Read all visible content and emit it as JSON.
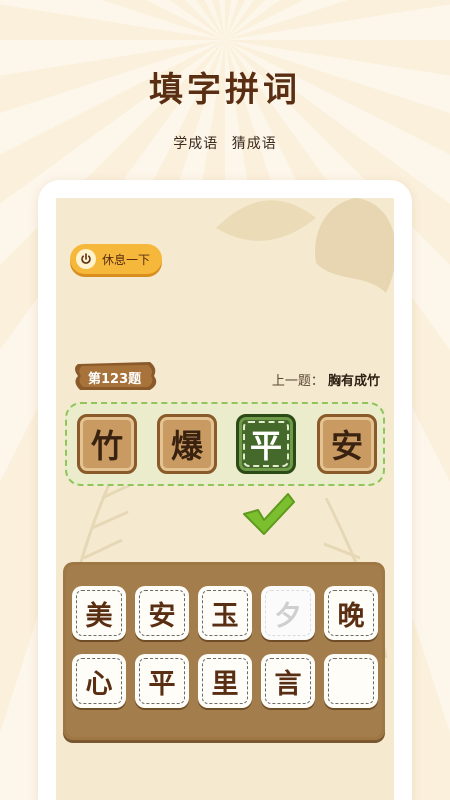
{
  "header": {
    "title": "填字拼词",
    "subtitle": [
      "学成语",
      "猜成语"
    ]
  },
  "game": {
    "rest_button": "休息一下",
    "level_label": "第123题",
    "previous": {
      "label": "上一题：",
      "answer": "胸有成竹"
    },
    "answer_tiles": [
      {
        "char": "竹",
        "state": "filled"
      },
      {
        "char": "爆",
        "state": "filled"
      },
      {
        "char": "平",
        "state": "selected"
      },
      {
        "char": "安",
        "state": "filled"
      }
    ],
    "candidates": [
      {
        "char": "美",
        "used": false
      },
      {
        "char": "安",
        "used": false
      },
      {
        "char": "玉",
        "used": false
      },
      {
        "char": "夕",
        "used": true
      },
      {
        "char": "晚",
        "used": false
      },
      {
        "char": "心",
        "used": false
      },
      {
        "char": "平",
        "used": false
      },
      {
        "char": "里",
        "used": false
      },
      {
        "char": "言",
        "used": false
      },
      {
        "char": "",
        "used": false
      }
    ]
  },
  "colors": {
    "title": "#5a2e12",
    "rest_button": "#f6b83a",
    "selected_tile": "#44692a",
    "check": "#7cbf2e",
    "board": "#9e7744"
  }
}
